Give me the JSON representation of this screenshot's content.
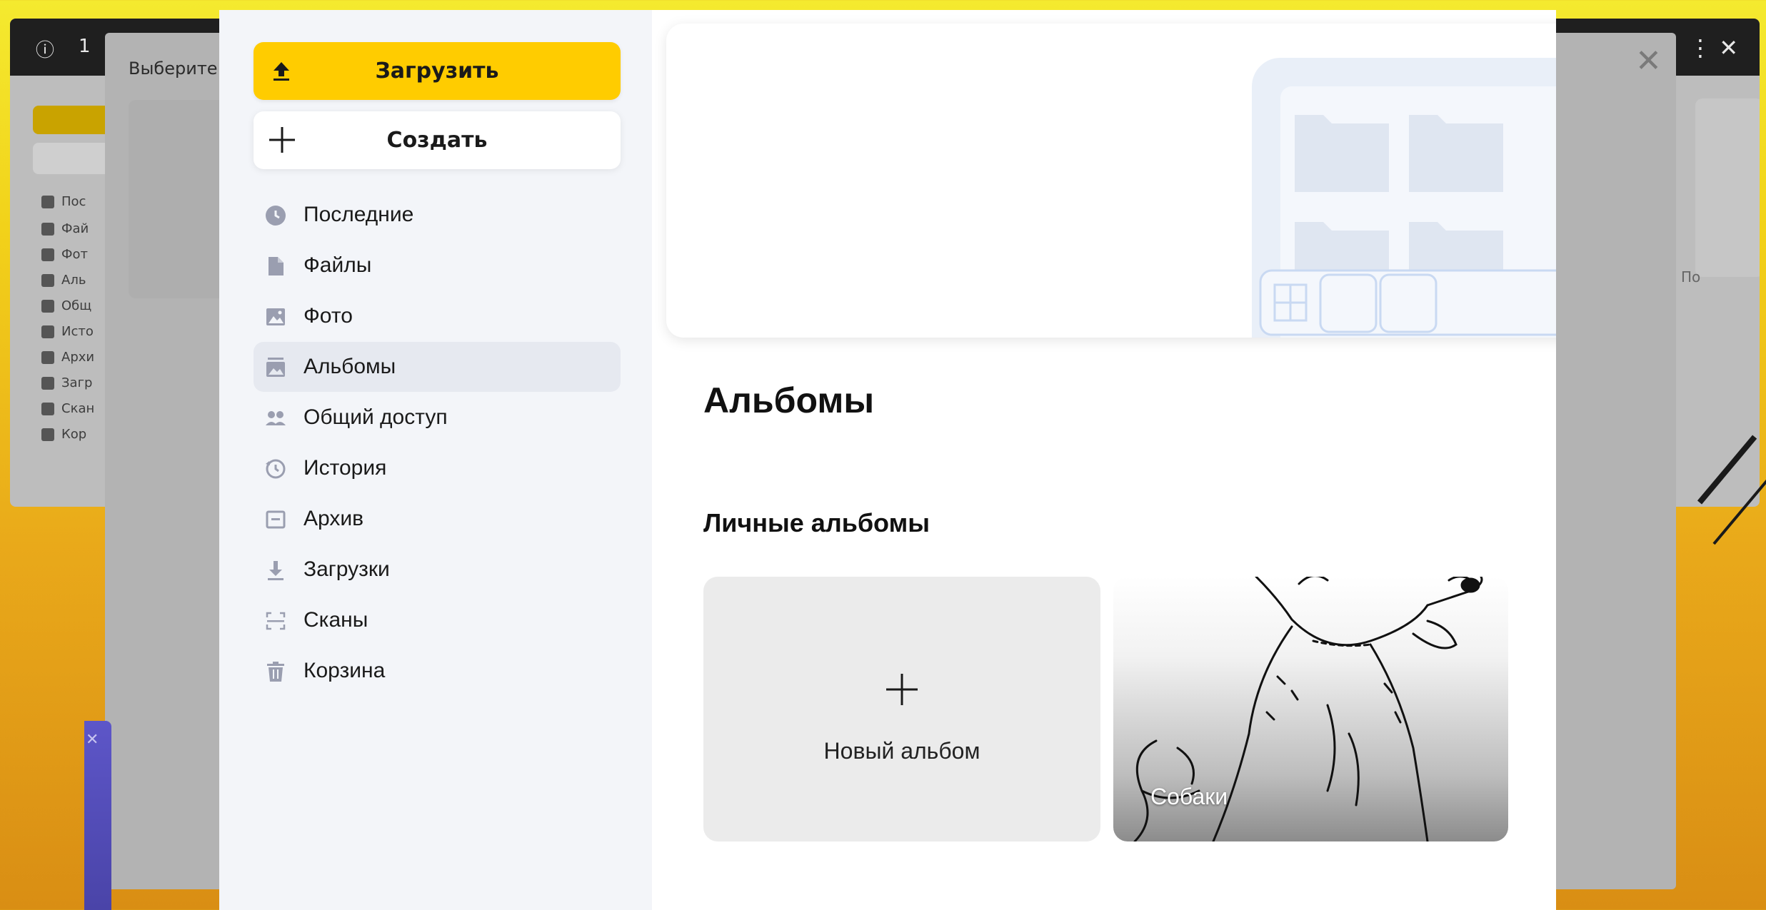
{
  "background_window": {
    "title_fragment": "1",
    "nav_fragments": [
      "Пос",
      "Фай",
      "Фот",
      "Аль",
      "Общ",
      "Исто",
      "Архи",
      "Загр",
      "Скан",
      "Кор"
    ],
    "side_fragment": "По"
  },
  "frame": {
    "label": "Выберите"
  },
  "sidebar": {
    "upload_label": "Загрузить",
    "create_label": "Создать",
    "items": [
      {
        "label": "Последние",
        "icon": "clock-icon"
      },
      {
        "label": "Файлы",
        "icon": "file-icon"
      },
      {
        "label": "Фото",
        "icon": "photo-icon"
      },
      {
        "label": "Альбомы",
        "icon": "album-icon"
      },
      {
        "label": "Общий доступ",
        "icon": "shared-users-icon"
      },
      {
        "label": "История",
        "icon": "history-icon"
      },
      {
        "label": "Архив",
        "icon": "archive-icon"
      },
      {
        "label": "Загрузки",
        "icon": "download-icon"
      },
      {
        "label": "Сканы",
        "icon": "scan-icon"
      },
      {
        "label": "Корзина",
        "icon": "trash-icon"
      }
    ],
    "active_index": 3
  },
  "main": {
    "page_title": "Альбомы",
    "section_title": "Личные альбомы",
    "new_album_label": "Новый альбом",
    "albums": [
      {
        "title": "Собаки"
      }
    ]
  },
  "colors": {
    "accent": "#ffcc00",
    "sidebar_bg": "#f3f5f9",
    "active_item_bg": "#e6e9f0",
    "icon_color": "#9a9eb0",
    "banner_illustration": "#c9d9f2"
  }
}
